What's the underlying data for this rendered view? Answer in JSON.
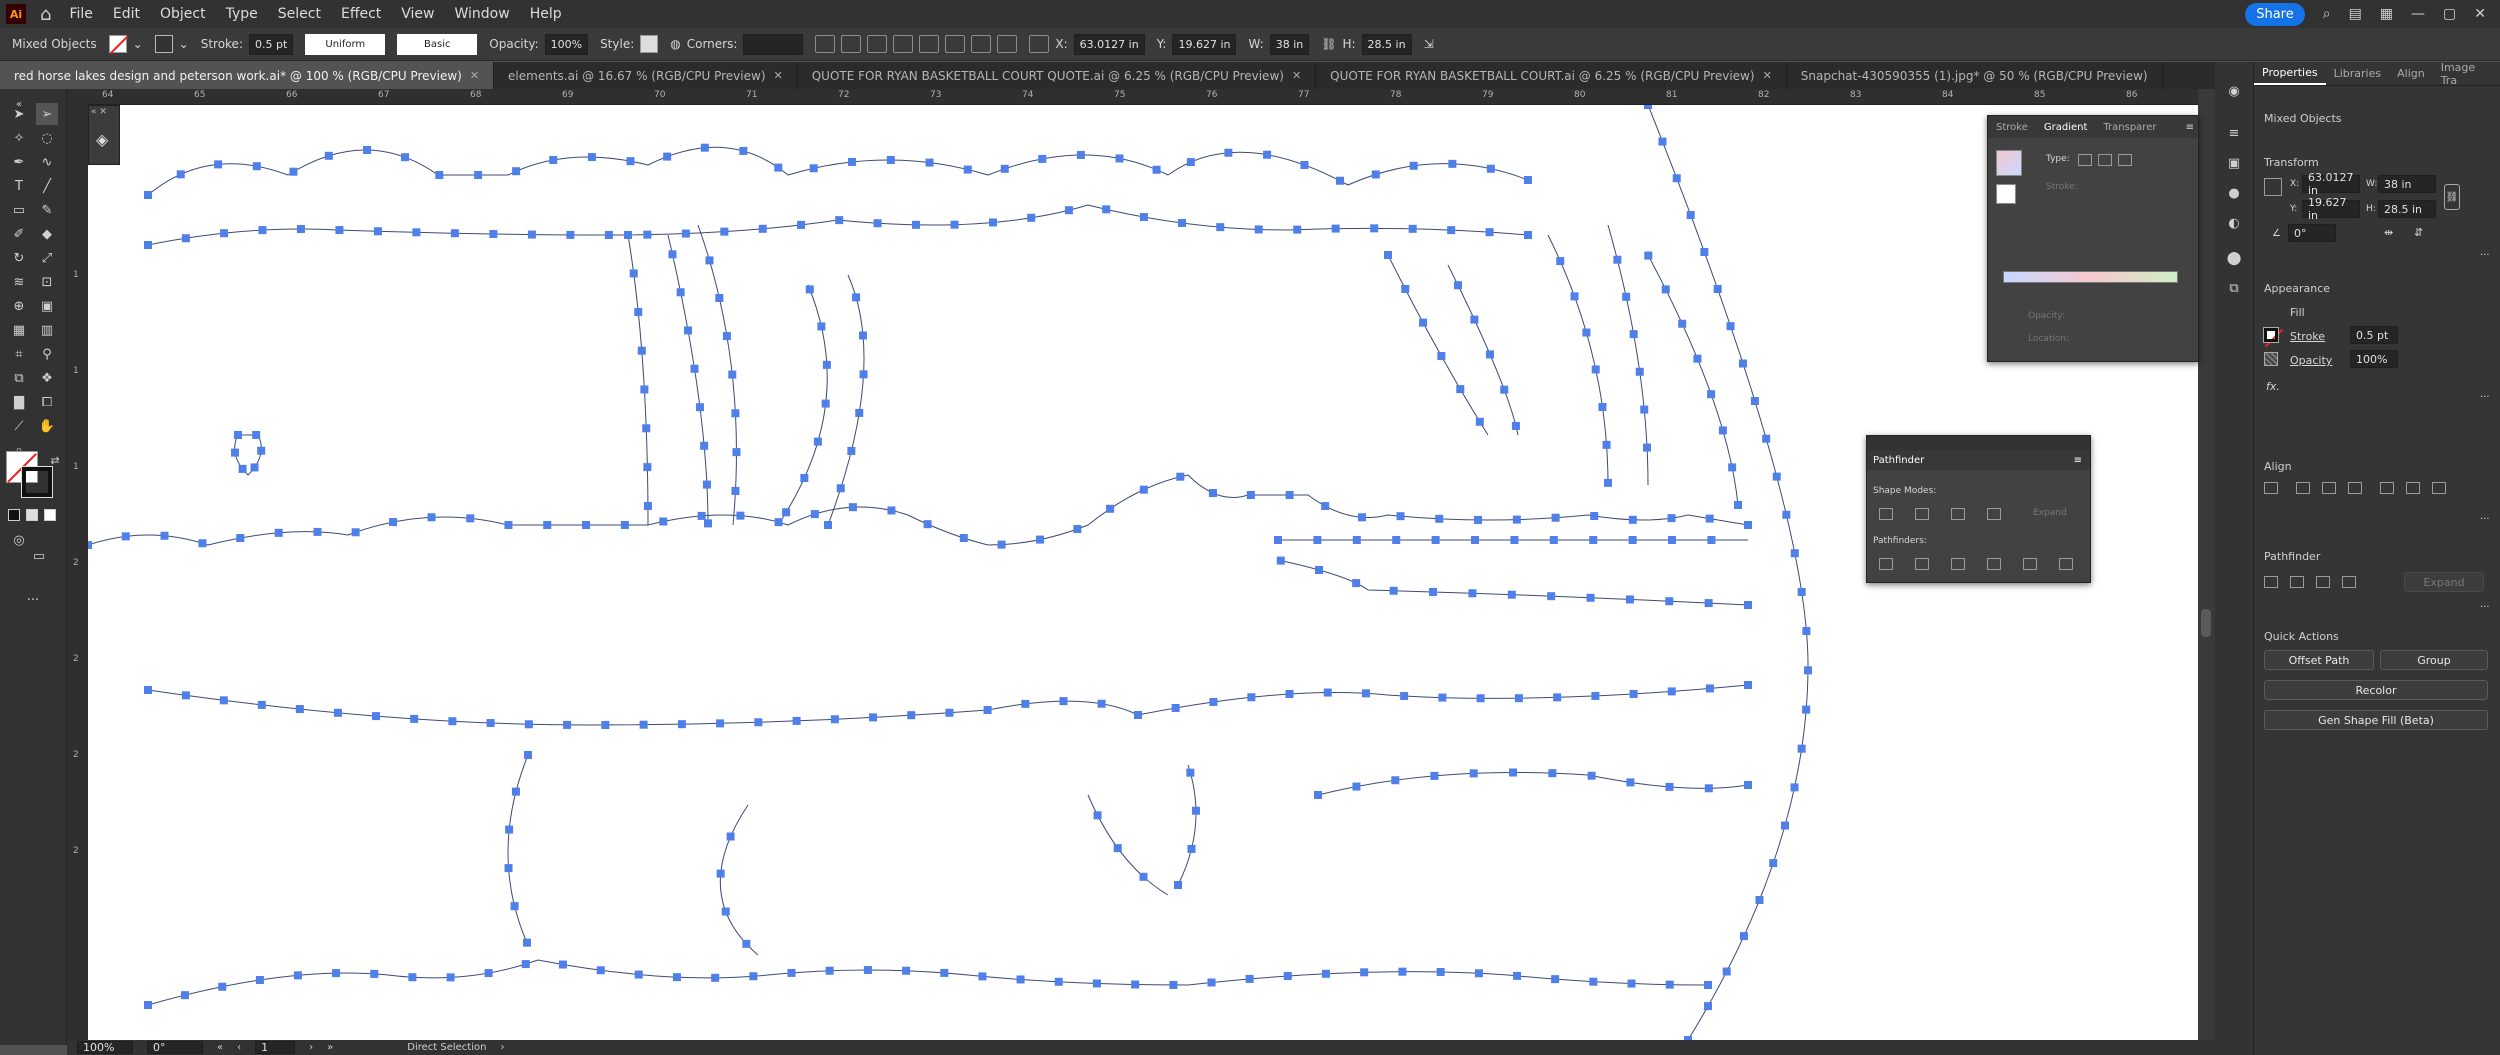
{
  "app": {
    "logo": "Ai"
  },
  "menu": [
    "File",
    "Edit",
    "Object",
    "Type",
    "Select",
    "Effect",
    "View",
    "Window",
    "Help"
  ],
  "share_label": "Share",
  "control": {
    "selection_label": "Mixed Objects",
    "stroke_label": "Stroke:",
    "stroke_value": "0.5 pt",
    "profile_value": "Uniform",
    "brush_value": "Basic",
    "opacity_label": "Opacity:",
    "opacity_value": "100%",
    "style_label": "Style:",
    "corners_label": "Corners:",
    "x_label": "X:",
    "x_value": "63.0127 in",
    "y_label": "Y:",
    "y_value": "19.627 in",
    "w_label": "W:",
    "w_value": "38 in",
    "h_label": "H:",
    "h_value": "28.5 in"
  },
  "tabs": [
    {
      "label": "red horse lakes design and peterson work.ai* @ 100 % (RGB/CPU Preview)",
      "active": true
    },
    {
      "label": "elements.ai @ 16.67 % (RGB/CPU Preview)"
    },
    {
      "label": "QUOTE FOR RYAN BASKETBALL COURT QUOTE.ai @ 6.25 % (RGB/CPU Preview)"
    },
    {
      "label": "QUOTE FOR RYAN BASKETBALL COURT.ai @ 6.25 % (RGB/CPU Preview)"
    },
    {
      "label": "Snapchat-430590355 (1).jpg* @ 50 % (RGB/CPU Preview)"
    }
  ],
  "ruler_top": [
    "64",
    "65",
    "66",
    "67",
    "68",
    "69",
    "70",
    "71",
    "72",
    "73",
    "74",
    "75",
    "76",
    "77",
    "78",
    "79",
    "80",
    "81",
    "82",
    "83",
    "84",
    "85",
    "86"
  ],
  "ruler_left": [
    "1",
    "1",
    "1",
    "2",
    "2",
    "2",
    "2"
  ],
  "status": {
    "zoom": "100%",
    "rotation": "0°",
    "artboard": "1",
    "tool": "Direct Selection"
  },
  "gradient_panel": {
    "tabs": [
      "Stroke",
      "Gradient",
      "Transparer"
    ],
    "type_label": "Type:",
    "stroke_label": "Stroke:",
    "opacity_label": "Opacity:",
    "location_label": "Location:"
  },
  "pathfinder_float": {
    "title": "Pathfinder",
    "shape_modes_label": "Shape Modes:",
    "pathfinders_label": "Pathfinders:",
    "expand_label": "Expand"
  },
  "properties": {
    "tabs": [
      "Properties",
      "Libraries",
      "Align",
      "Image Tra"
    ],
    "selection": "Mixed Objects",
    "transform_title": "Transform",
    "x_label": "X:",
    "x_value": "63.0127 in",
    "y_label": "Y:",
    "y_value": "19.627 in",
    "w_label": "W:",
    "w_value": "38 in",
    "h_label": "H:",
    "h_value": "28.5 in",
    "rotate_value": "0°",
    "appearance_title": "Appearance",
    "fill_label": "Fill",
    "stroke_label": "Stroke",
    "stroke_value": "0.5 pt",
    "opacity_label": "Opacity",
    "opacity_value": "100%",
    "fx_label": "fx.",
    "align_title": "Align",
    "pathfinder_title": "Pathfinder",
    "expand_label": "Expand",
    "quick_title": "Quick Actions",
    "offset_path": "Offset Path",
    "group": "Group",
    "recolor": "Recolor",
    "gen_shape": "Gen Shape Fill (Beta)"
  },
  "colors": {
    "anchor": "#4f7fe8",
    "path": "#3b4a78",
    "accent": "#1473e6"
  }
}
